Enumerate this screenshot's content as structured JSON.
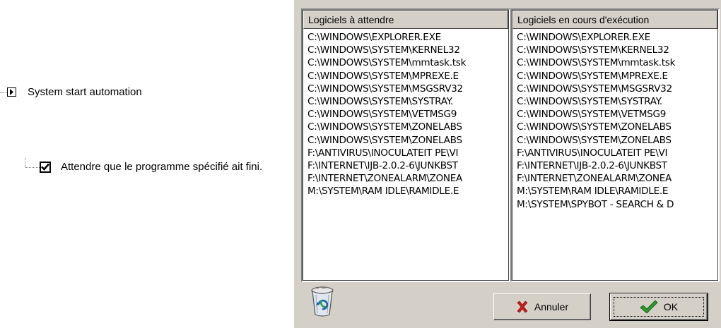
{
  "tree": {
    "node1_label": "System start automation",
    "node2_label": "Attendre que le programme spécifié ait fini.",
    "node2_checked": true
  },
  "dialog": {
    "left_list": {
      "header": "Logiciels à attendre",
      "items": [
        "C:\\WINDOWS\\EXPLORER.EXE",
        "C:\\WINDOWS\\SYSTEM\\KERNEL32",
        "C:\\WINDOWS\\SYSTEM\\mmtask.tsk",
        "C:\\WINDOWS\\SYSTEM\\MPREXE.E",
        "C:\\WINDOWS\\SYSTEM\\MSGSRV32",
        "C:\\WINDOWS\\SYSTEM\\SYSTRAY.",
        "C:\\WINDOWS\\SYSTEM\\VETMSG9",
        "C:\\WINDOWS\\SYSTEM\\ZONELABS",
        "C:\\WINDOWS\\SYSTEM\\ZONELABS",
        "F:\\ANTIVIRUS\\INOCULATEIT PE\\VI",
        "F:\\INTERNET\\IJB-2.0.2-6\\JUNKBST",
        "F:\\INTERNET\\ZONEALARM\\ZONEA",
        "M:\\SYSTEM\\RAM IDLE\\RAMIDLE.E"
      ]
    },
    "right_list": {
      "header": "Logiciels en cours d'exécution",
      "items": [
        "C:\\WINDOWS\\EXPLORER.EXE",
        "C:\\WINDOWS\\SYSTEM\\KERNEL32",
        "C:\\WINDOWS\\SYSTEM\\mmtask.tsk",
        "C:\\WINDOWS\\SYSTEM\\MPREXE.E",
        "C:\\WINDOWS\\SYSTEM\\MSGSRV32",
        "C:\\WINDOWS\\SYSTEM\\SYSTRAY.",
        "C:\\WINDOWS\\SYSTEM\\VETMSG9",
        "C:\\WINDOWS\\SYSTEM\\ZONELABS",
        "C:\\WINDOWS\\SYSTEM\\ZONELABS",
        "F:\\ANTIVIRUS\\INOCULATEIT PE\\VI",
        "F:\\INTERNET\\IJB-2.0.2-6\\JUNKBST",
        "F:\\INTERNET\\ZONEALARM\\ZONEA",
        "M:\\SYSTEM\\RAM IDLE\\RAMIDLE.E",
        "M:\\SYSTEM\\SPYBOT - SEARCH & D"
      ]
    },
    "cancel_label": "Annuler",
    "ok_label": "OK",
    "icons": {
      "cancel": "red-x-icon",
      "ok": "green-check-icon",
      "recycle": "recycle-bin-icon"
    },
    "colors": {
      "face": "#d4d0c8",
      "cancel_icon": "#cc1a1a",
      "ok_icon": "#2a9a2a"
    }
  }
}
